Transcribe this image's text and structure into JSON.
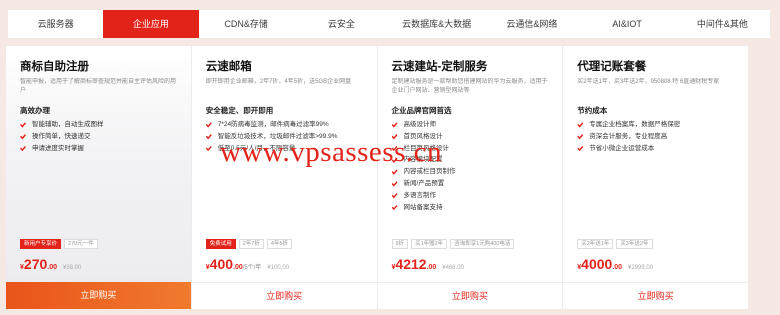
{
  "tabs": [
    {
      "label": "云服务器",
      "active": false
    },
    {
      "label": "企业应用",
      "active": true
    },
    {
      "label": "CDN&存储",
      "active": false
    },
    {
      "label": "云安全",
      "active": false
    },
    {
      "label": "云数据库&大数据",
      "active": false
    },
    {
      "label": "云通信&网络",
      "active": false
    },
    {
      "label": "AI&IOT",
      "active": false
    },
    {
      "label": "中间件&其他",
      "active": false
    }
  ],
  "cards": [
    {
      "title": "商标自助注册",
      "desc": "智能申报，适用于了解商标审查规范并能自主评估风险的用户",
      "section": "高效办理",
      "features": [
        "智能辅助，自动生成图样",
        "操作简单，快速递交",
        "申请进度实时掌握"
      ],
      "tags": [
        {
          "text": "新用户专享价",
          "hot": true
        },
        {
          "text": "270元一件",
          "hot": false
        }
      ],
      "price": {
        "currency": "¥",
        "amount": "270",
        "decimals": ".00",
        "unit": ""
      },
      "old_price": "¥38.00",
      "buy_label": "立即购买"
    },
    {
      "title": "云速邮箱",
      "desc": "即开即用企业邮箱，2年7折，4年5折，送5GB企业网盘",
      "section": "安全稳定、即开即用",
      "features": [
        "7*24防病毒监测，邮件病毒过滤率99%",
        "智能反垃圾技术，垃圾邮件过滤率>99.9%",
        "低至0.5元/人/月，不限容量"
      ],
      "tags": [
        {
          "text": "免费试用",
          "hot": true
        },
        {
          "text": "2年7折",
          "hot": false
        },
        {
          "text": "4年5折",
          "hot": false
        }
      ],
      "price": {
        "currency": "¥",
        "amount": "400",
        "decimals": ".00",
        "unit": "/5个/年"
      },
      "old_price": "¥100.00",
      "buy_label": "立即购买"
    },
    {
      "title": "云速建站-定制服务",
      "desc": "定制建站服务是一款帮助您搭建网站的华为云服务，适用于企业门户网站、营销型网站等",
      "section": "企业品牌官网首选",
      "features": [
        "高级设计师",
        "首页风格设计",
        "栏目页风格设计",
        "内容模块配置",
        "内容或栏目页制作",
        "新闻/产品预置",
        "多语言制作",
        "网站备案支持"
      ],
      "tags": [
        {
          "text": "9折",
          "hot": false
        },
        {
          "text": "买1年赠2年",
          "hot": false
        },
        {
          "text": "咨询即享1元购400电话",
          "hot": false
        }
      ],
      "price": {
        "currency": "¥",
        "amount": "4212",
        "decimals": ".00",
        "unit": ""
      },
      "old_price": "¥468.00",
      "buy_label": "立即购买"
    },
    {
      "title": "代理记账套餐",
      "desc": "买2年送1年，买3年送2年，950808 特 6直通财税专家",
      "section": "节约成本",
      "features": [
        "专属企业档案库，数据严格保密",
        "资深会计服务，专业程度高",
        "节省小微企业运营成本"
      ],
      "tags": [
        {
          "text": "买2年送1年",
          "hot": false
        },
        {
          "text": "买3年送2年",
          "hot": false
        }
      ],
      "price": {
        "currency": "¥",
        "amount": "4000",
        "decimals": ".00",
        "unit": ""
      },
      "old_price": "¥2999.00",
      "buy_label": "立即购买"
    }
  ],
  "watermark": "www.vpsassess.cn",
  "colors": {
    "accent": "#e2231a",
    "buy_gradient_start": "#e9541a",
    "buy_gradient_end": "#f07a2e",
    "background": "#f6e9e4"
  }
}
